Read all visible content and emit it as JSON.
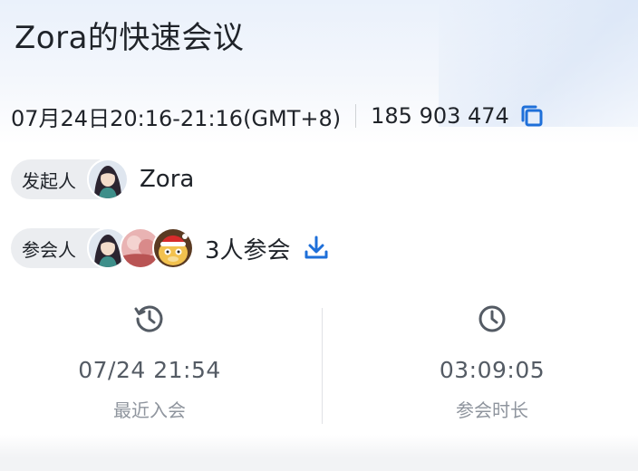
{
  "meeting": {
    "title": "Zora的快速会议",
    "time_range": "07月24日20:16-21:16(GMT+8)",
    "meeting_id": "185 903 474"
  },
  "host": {
    "label": "发起人",
    "name": "Zora"
  },
  "participants": {
    "label": "参会人",
    "count_text": "3人参会"
  },
  "stats": {
    "last_join": {
      "value": "07/24 21:54",
      "label": "最近入会"
    },
    "duration": {
      "value": "03:09:05",
      "label": "参会时长"
    }
  },
  "colors": {
    "accent": "#1e6fd9",
    "text_primary": "#1f2329",
    "text_secondary": "#545b64",
    "text_tertiary": "#8f959e",
    "pill_bg": "#ebedf0"
  },
  "icons": {
    "copy": "copy-icon",
    "download": "download-icon",
    "history": "history-icon",
    "clock": "clock-icon"
  }
}
